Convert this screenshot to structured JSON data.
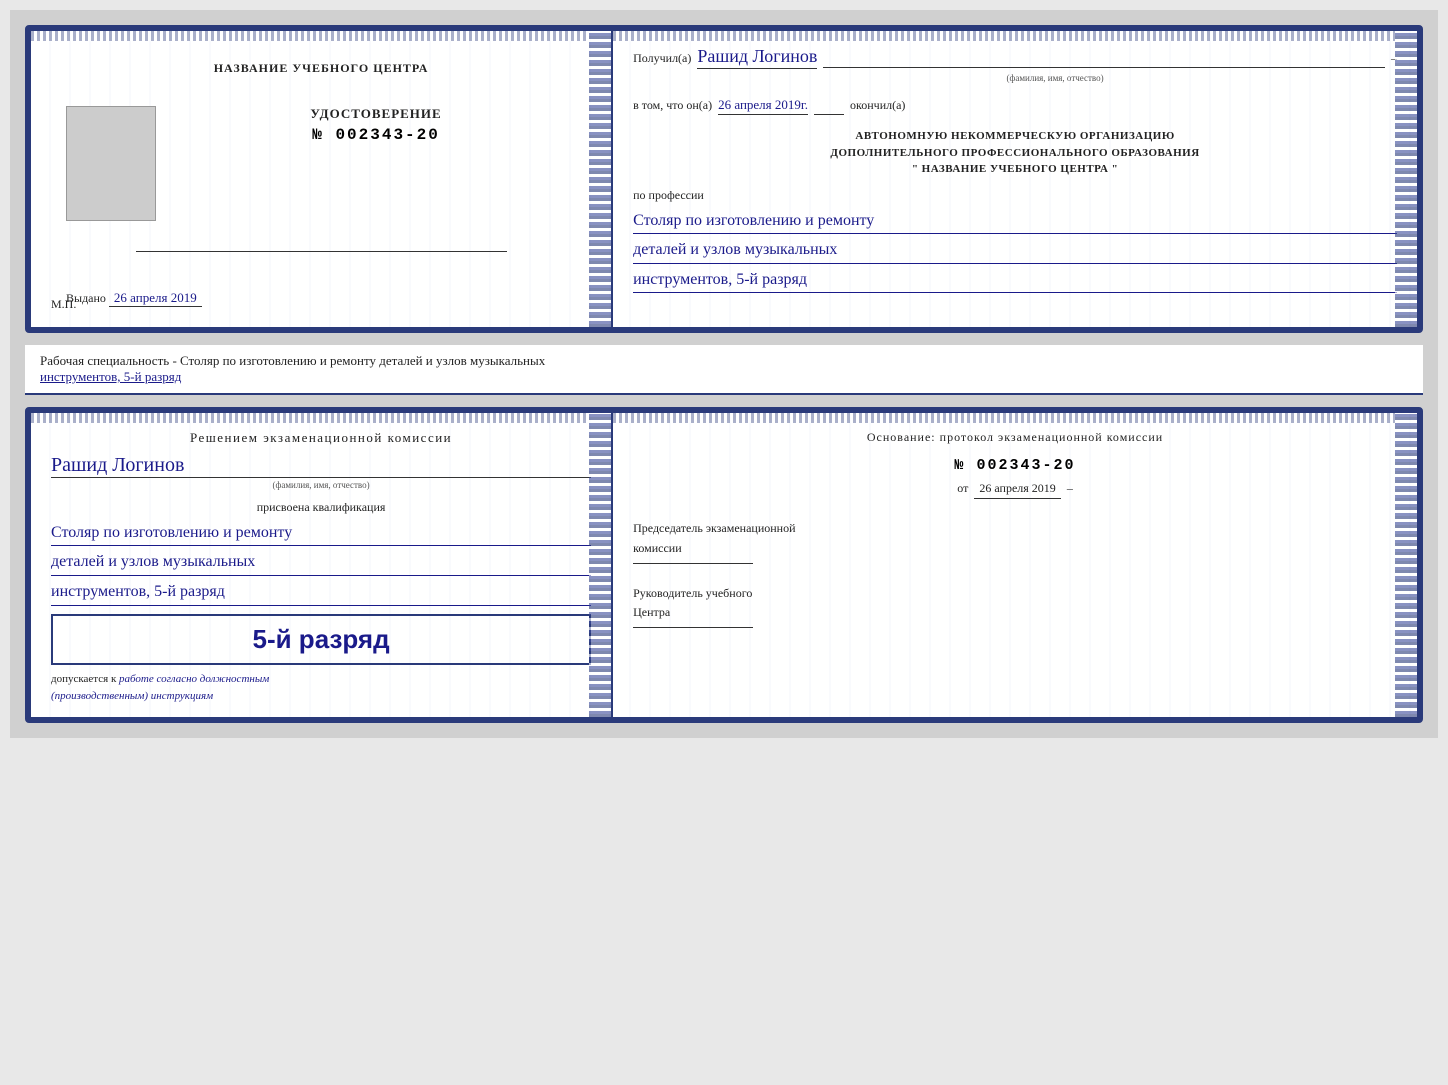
{
  "page": {
    "background": "#d0d0d0"
  },
  "top_card": {
    "left": {
      "org_name": "НАЗВАНИЕ УЧЕБНОГО ЦЕНТРА",
      "doc_type": "УДОСТОВЕРЕНИЕ",
      "doc_number": "№ 002343-20",
      "issued_label": "Выдано",
      "issued_date": "26 апреля 2019",
      "mp_label": "М.П."
    },
    "right": {
      "received_prefix": "Получил(а)",
      "recipient_name": "Рашид Логинов",
      "name_sublabel": "(фамилия, имя, отчество)",
      "in_that_prefix": "в том, что он(а)",
      "date_graduated": "26 апреля 2019г.",
      "graduated_label": "окончил(а)",
      "org_type_line1": "АВТОНОМНУЮ НЕКОММЕРЧЕСКУЮ ОРГАНИЗАЦИЮ",
      "org_type_line2": "ДОПОЛНИТЕЛЬНОГО ПРОФЕССИОНАЛЬНОГО ОБРАЗОВАНИЯ",
      "org_name_quoted": "\"   НАЗВАНИЕ УЧЕБНОГО ЦЕНТРА   \"",
      "profession_prefix": "по профессии",
      "profession_line1": "Столяр по изготовлению и ремонту",
      "profession_line2": "деталей и узлов музыкальных",
      "profession_line3": "инструментов, 5-й разряд"
    }
  },
  "info_text": {
    "line1": "Рабочая специальность - Столяр по изготовлению и ремонту деталей и узлов музыкальных",
    "line2": "инструментов, 5-й разряд"
  },
  "bottom_card": {
    "left": {
      "commission_line": "Решением экзаменационной комиссии",
      "recipient_name": "Рашид Логинов",
      "name_sublabel": "(фамилия, имя, отчество)",
      "assigned_label": "присвоена квалификация",
      "profession_line1": "Столяр по изготовлению и ремонту",
      "profession_line2": "деталей и узлов музыкальных",
      "profession_line3": "инструментов, 5-й разряд",
      "rank_big": "5-й разряд",
      "allowed_prefix": "допускается к",
      "allowed_italic": "работе согласно должностным",
      "allowed_italic2": "(производственным) инструкциям"
    },
    "right": {
      "basis_label": "Основание: протокол экзаменационной комиссии",
      "protocol_number": "№  002343-20",
      "date_prefix": "от",
      "date_value": "26 апреля 2019",
      "chairman_line1": "Председатель экзаменационной",
      "chairman_line2": "комиссии",
      "head_line1": "Руководитель учебного",
      "head_line2": "Центра"
    }
  }
}
